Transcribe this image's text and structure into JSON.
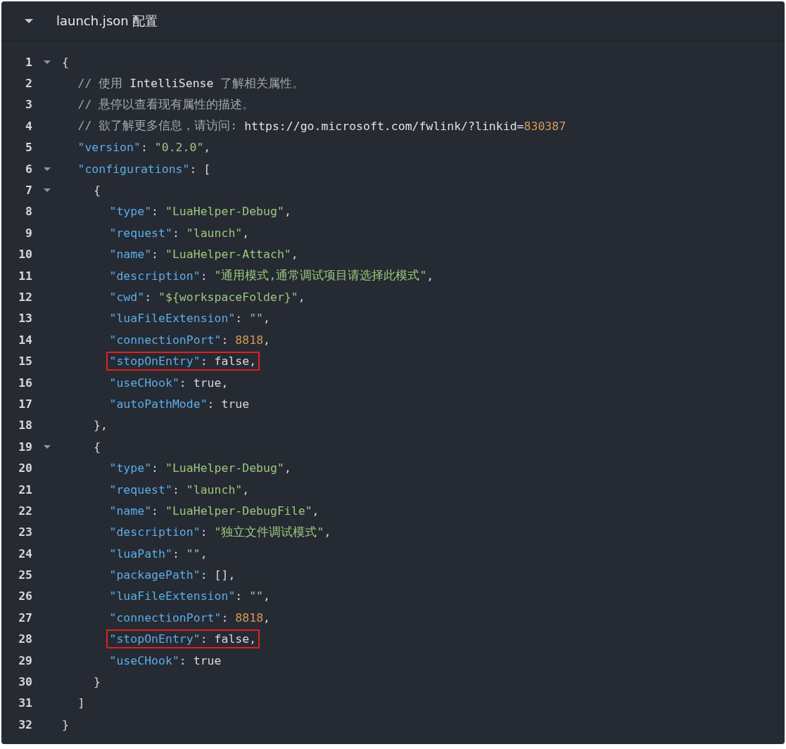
{
  "header": {
    "title": "launch.json 配置",
    "expanded": true
  },
  "lines": [
    {
      "num": "1",
      "fold": true,
      "tokens": [
        {
          "kind": "punct",
          "text": "{"
        }
      ],
      "children": [
        {
          "num": "2",
          "tokens": [
            {
              "kind": "comment",
              "text": "// 使用 "
            },
            {
              "kind": "plain",
              "text": "IntelliSense"
            },
            {
              "kind": "comment",
              "text": " 了解相关属性。"
            }
          ]
        },
        {
          "num": "3",
          "tokens": [
            {
              "kind": "comment",
              "text": "// 悬停以查看现有属性的描述。"
            }
          ]
        },
        {
          "num": "4",
          "tokens": [
            {
              "kind": "comment",
              "text": "// 欲了解更多信息，请访问: "
            },
            {
              "kind": "plain",
              "text": "https://go.microsoft.com/fwlink/?linkid="
            },
            {
              "kind": "number",
              "text": "830387"
            }
          ]
        },
        {
          "num": "5",
          "tokens": [
            {
              "kind": "key",
              "text": "\"version\""
            },
            {
              "kind": "punct",
              "text": ": "
            },
            {
              "kind": "string",
              "text": "\"0.2.0\""
            },
            {
              "kind": "punct",
              "text": ","
            }
          ]
        },
        {
          "num": "6",
          "fold": true,
          "tokens": [
            {
              "kind": "key",
              "text": "\"configurations\""
            },
            {
              "kind": "punct",
              "text": ": ["
            }
          ],
          "children": [
            {
              "num": "7",
              "fold": true,
              "tokens": [
                {
                  "kind": "punct",
                  "text": "{"
                }
              ],
              "children": [
                {
                  "num": "8",
                  "tokens": [
                    {
                      "kind": "key",
                      "text": "\"type\""
                    },
                    {
                      "kind": "punct",
                      "text": ": "
                    },
                    {
                      "kind": "string",
                      "text": "\"LuaHelper-Debug\""
                    },
                    {
                      "kind": "punct",
                      "text": ","
                    }
                  ]
                },
                {
                  "num": "9",
                  "tokens": [
                    {
                      "kind": "key",
                      "text": "\"request\""
                    },
                    {
                      "kind": "punct",
                      "text": ": "
                    },
                    {
                      "kind": "string",
                      "text": "\"launch\""
                    },
                    {
                      "kind": "punct",
                      "text": ","
                    }
                  ]
                },
                {
                  "num": "10",
                  "tokens": [
                    {
                      "kind": "key",
                      "text": "\"name\""
                    },
                    {
                      "kind": "punct",
                      "text": ": "
                    },
                    {
                      "kind": "string",
                      "text": "\"LuaHelper-Attach\""
                    },
                    {
                      "kind": "punct",
                      "text": ","
                    }
                  ]
                },
                {
                  "num": "11",
                  "tokens": [
                    {
                      "kind": "key",
                      "text": "\"description\""
                    },
                    {
                      "kind": "punct",
                      "text": ": "
                    },
                    {
                      "kind": "string",
                      "text": "\"通用模式,通常调试项目请选择此模式\""
                    },
                    {
                      "kind": "punct",
                      "text": ","
                    }
                  ]
                },
                {
                  "num": "12",
                  "tokens": [
                    {
                      "kind": "key",
                      "text": "\"cwd\""
                    },
                    {
                      "kind": "punct",
                      "text": ": "
                    },
                    {
                      "kind": "string",
                      "text": "\"${workspaceFolder}\""
                    },
                    {
                      "kind": "punct",
                      "text": ","
                    }
                  ]
                },
                {
                  "num": "13",
                  "tokens": [
                    {
                      "kind": "key",
                      "text": "\"luaFileExtension\""
                    },
                    {
                      "kind": "punct",
                      "text": ": "
                    },
                    {
                      "kind": "string",
                      "text": "\"\""
                    },
                    {
                      "kind": "punct",
                      "text": ","
                    }
                  ]
                },
                {
                  "num": "14",
                  "tokens": [
                    {
                      "kind": "key",
                      "text": "\"connectionPort\""
                    },
                    {
                      "kind": "punct",
                      "text": ": "
                    },
                    {
                      "kind": "number",
                      "text": "8818"
                    },
                    {
                      "kind": "punct",
                      "text": ","
                    }
                  ]
                },
                {
                  "num": "15",
                  "boxed": true,
                  "tokens": [
                    {
                      "kind": "key",
                      "text": "\"stopOnEntry\""
                    },
                    {
                      "kind": "punct",
                      "text": ": false,"
                    }
                  ]
                },
                {
                  "num": "16",
                  "tokens": [
                    {
                      "kind": "key",
                      "text": "\"useCHook\""
                    },
                    {
                      "kind": "punct",
                      "text": ": true,"
                    }
                  ]
                },
                {
                  "num": "17",
                  "tokens": [
                    {
                      "kind": "key",
                      "text": "\"autoPathMode\""
                    },
                    {
                      "kind": "punct",
                      "text": ": true"
                    }
                  ]
                }
              ]
            },
            {
              "num": "18",
              "tokens": [
                {
                  "kind": "punct",
                  "text": "},"
                }
              ]
            },
            {
              "num": "19",
              "fold": true,
              "tokens": [
                {
                  "kind": "punct",
                  "text": "{"
                }
              ],
              "children": [
                {
                  "num": "20",
                  "tokens": [
                    {
                      "kind": "key",
                      "text": "\"type\""
                    },
                    {
                      "kind": "punct",
                      "text": ": "
                    },
                    {
                      "kind": "string",
                      "text": "\"LuaHelper-Debug\""
                    },
                    {
                      "kind": "punct",
                      "text": ","
                    }
                  ]
                },
                {
                  "num": "21",
                  "tokens": [
                    {
                      "kind": "key",
                      "text": "\"request\""
                    },
                    {
                      "kind": "punct",
                      "text": ": "
                    },
                    {
                      "kind": "string",
                      "text": "\"launch\""
                    },
                    {
                      "kind": "punct",
                      "text": ","
                    }
                  ]
                },
                {
                  "num": "22",
                  "tokens": [
                    {
                      "kind": "key",
                      "text": "\"name\""
                    },
                    {
                      "kind": "punct",
                      "text": ": "
                    },
                    {
                      "kind": "string",
                      "text": "\"LuaHelper-DebugFile\""
                    },
                    {
                      "kind": "punct",
                      "text": ","
                    }
                  ]
                },
                {
                  "num": "23",
                  "tokens": [
                    {
                      "kind": "key",
                      "text": "\"description\""
                    },
                    {
                      "kind": "punct",
                      "text": ": "
                    },
                    {
                      "kind": "string",
                      "text": "\"独立文件调试模式\""
                    },
                    {
                      "kind": "punct",
                      "text": ","
                    }
                  ]
                },
                {
                  "num": "24",
                  "tokens": [
                    {
                      "kind": "key",
                      "text": "\"luaPath\""
                    },
                    {
                      "kind": "punct",
                      "text": ": "
                    },
                    {
                      "kind": "string",
                      "text": "\"\""
                    },
                    {
                      "kind": "punct",
                      "text": ","
                    }
                  ]
                },
                {
                  "num": "25",
                  "tokens": [
                    {
                      "kind": "key",
                      "text": "\"packagePath\""
                    },
                    {
                      "kind": "punct",
                      "text": ": [],"
                    }
                  ]
                },
                {
                  "num": "26",
                  "tokens": [
                    {
                      "kind": "key",
                      "text": "\"luaFileExtension\""
                    },
                    {
                      "kind": "punct",
                      "text": ": "
                    },
                    {
                      "kind": "string",
                      "text": "\"\""
                    },
                    {
                      "kind": "punct",
                      "text": ","
                    }
                  ]
                },
                {
                  "num": "27",
                  "tokens": [
                    {
                      "kind": "key",
                      "text": "\"connectionPort\""
                    },
                    {
                      "kind": "punct",
                      "text": ": "
                    },
                    {
                      "kind": "number",
                      "text": "8818"
                    },
                    {
                      "kind": "punct",
                      "text": ","
                    }
                  ]
                },
                {
                  "num": "28",
                  "boxed": true,
                  "tokens": [
                    {
                      "kind": "key",
                      "text": "\"stopOnEntry\""
                    },
                    {
                      "kind": "punct",
                      "text": ": false,"
                    }
                  ]
                },
                {
                  "num": "29",
                  "tokens": [
                    {
                      "kind": "key",
                      "text": "\"useCHook\""
                    },
                    {
                      "kind": "punct",
                      "text": ": true"
                    }
                  ]
                }
              ]
            },
            {
              "num": "30",
              "tokens": [
                {
                  "kind": "punct",
                  "text": "}"
                }
              ]
            }
          ]
        },
        {
          "num": "31",
          "tokens": [
            {
              "kind": "punct",
              "text": "]"
            }
          ]
        }
      ]
    },
    {
      "num": "32",
      "tokens": [
        {
          "kind": "punct",
          "text": "}"
        }
      ]
    }
  ]
}
